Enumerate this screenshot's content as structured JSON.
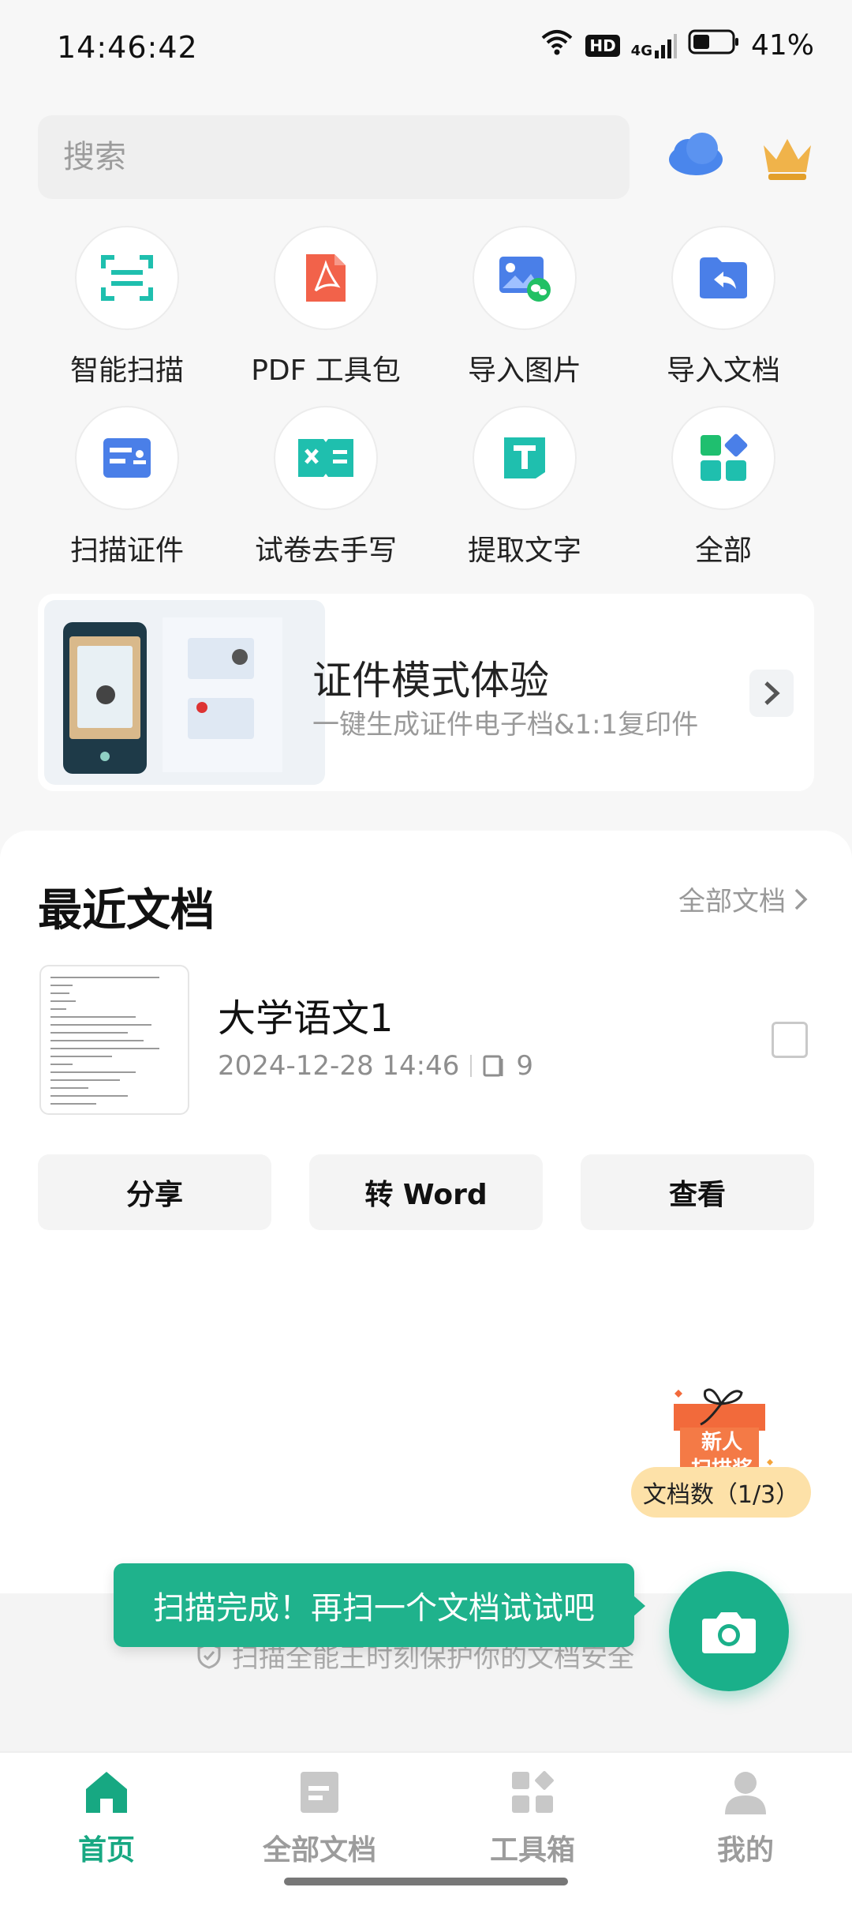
{
  "status_bar": {
    "time": "14:46:42",
    "network": "4G",
    "hd_badge": "HD",
    "battery": "41%"
  },
  "header": {
    "search_placeholder": "搜索",
    "cloud_icon": "cloud-icon",
    "vip_icon": "crown-icon"
  },
  "tools": [
    {
      "label": "智能扫描",
      "icon": "scan-icon"
    },
    {
      "label": "PDF 工具包",
      "icon": "pdf-icon"
    },
    {
      "label": "导入图片",
      "icon": "import-image-icon"
    },
    {
      "label": "导入文档",
      "icon": "import-doc-icon"
    },
    {
      "label": "扫描证件",
      "icon": "id-card-icon"
    },
    {
      "label": "试卷去手写",
      "icon": "exam-icon"
    },
    {
      "label": "提取文字",
      "icon": "text-extract-icon"
    },
    {
      "label": "全部",
      "icon": "all-apps-icon"
    }
  ],
  "banner": {
    "title": "证件模式体验",
    "subtitle": "一键生成证件电子档&1:1复印件"
  },
  "recent": {
    "title": "最近文档",
    "all_docs_label": "全部文档",
    "doc": {
      "name": "大学语文1",
      "date": "2024-12-28 14:46",
      "pages": "9"
    },
    "actions": [
      "分享",
      "转 Word",
      "查看"
    ]
  },
  "promo": {
    "gift_label_line1": "新人",
    "gift_label_line2": "扫描奖",
    "count_label": "文档数（1/3）"
  },
  "toast": "扫描完成！再扫一个文档试试吧",
  "safety_text": "扫描全能王时刻保护你的文档安全",
  "nav": [
    {
      "label": "首页",
      "active": true
    },
    {
      "label": "全部文档",
      "active": false
    },
    {
      "label": "工具箱",
      "active": false
    },
    {
      "label": "我的",
      "active": false
    }
  ],
  "colors": {
    "accent": "#17a882",
    "toast_bg": "#1fb28c",
    "pdf_red": "#f2624a",
    "blue": "#4a7fe8",
    "teal": "#1fbfae",
    "gift_orange": "#f26a3b",
    "gift_count_bg": "#fde1a8"
  }
}
